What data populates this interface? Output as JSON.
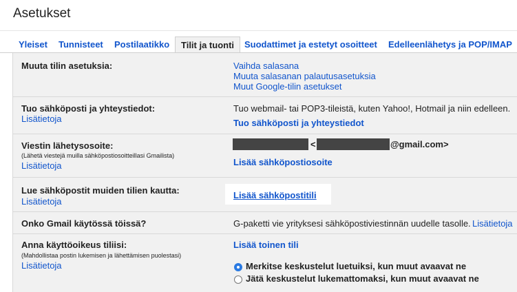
{
  "page_title": "Asetukset",
  "tabs": [
    {
      "label": "Yleiset"
    },
    {
      "label": "Tunnisteet"
    },
    {
      "label": "Postilaatikko"
    },
    {
      "label": "Tilit ja tuonti"
    },
    {
      "label": "Suodattimet ja estetyt osoitteet"
    },
    {
      "label": "Edelleenlähetys ja POP/IMAP"
    }
  ],
  "sections": {
    "change_account": {
      "label": "Muuta tilin asetuksia:",
      "links": [
        "Vaihda salasana",
        "Muuta salasanan palautusasetuksia",
        "Muut Google-tilin asetukset"
      ]
    },
    "import": {
      "label": "Tuo sähköposti ja yhteystiedot:",
      "learn_more": "Lisätietoja",
      "description": "Tuo webmail- tai POP3-tileistä, kuten Yahoo!, Hotmail ja niin edelleen.",
      "action": "Tuo sähköposti ja yhteystiedot"
    },
    "send_as": {
      "label": "Viestin lähetysosoite:",
      "sublabel": "(Lähetä viestejä muilla sähköpostiosoitteillasi Gmailista)",
      "learn_more": "Lisätietoja",
      "open_bracket": "<",
      "email_suffix": "@gmail.com>",
      "action": "Lisää sähköpostiosoite"
    },
    "check_mail": {
      "label": "Lue sähköpostit muiden tilien kautta:",
      "learn_more": "Lisätietoja",
      "action": "Lisää sähköpostitili"
    },
    "work": {
      "label": "Onko Gmail käytössä töissä?",
      "description": "G-paketti vie yrityksesi sähköpostiviestinnän uudelle tasolle.",
      "learn_more": "Lisätietoja"
    },
    "delegation": {
      "label": "Anna käyttöoikeus tiliisi:",
      "sublabel": "(Mahdollistaa postin lukemisen ja lähettämisen puolestasi)",
      "learn_more": "Lisätietoja",
      "action": "Lisää toinen tili",
      "options": [
        {
          "label": "Merkitse keskustelut luetuiksi, kun muut avaavat ne",
          "selected": true
        },
        {
          "label": "Jätä keskustelut lukemattomaksi, kun muut avaavat ne",
          "selected": false
        }
      ]
    }
  },
  "colors": {
    "link": "#1155cc",
    "panel_bg": "#f1f1f1",
    "radio_selected": "#2a7ae2"
  }
}
